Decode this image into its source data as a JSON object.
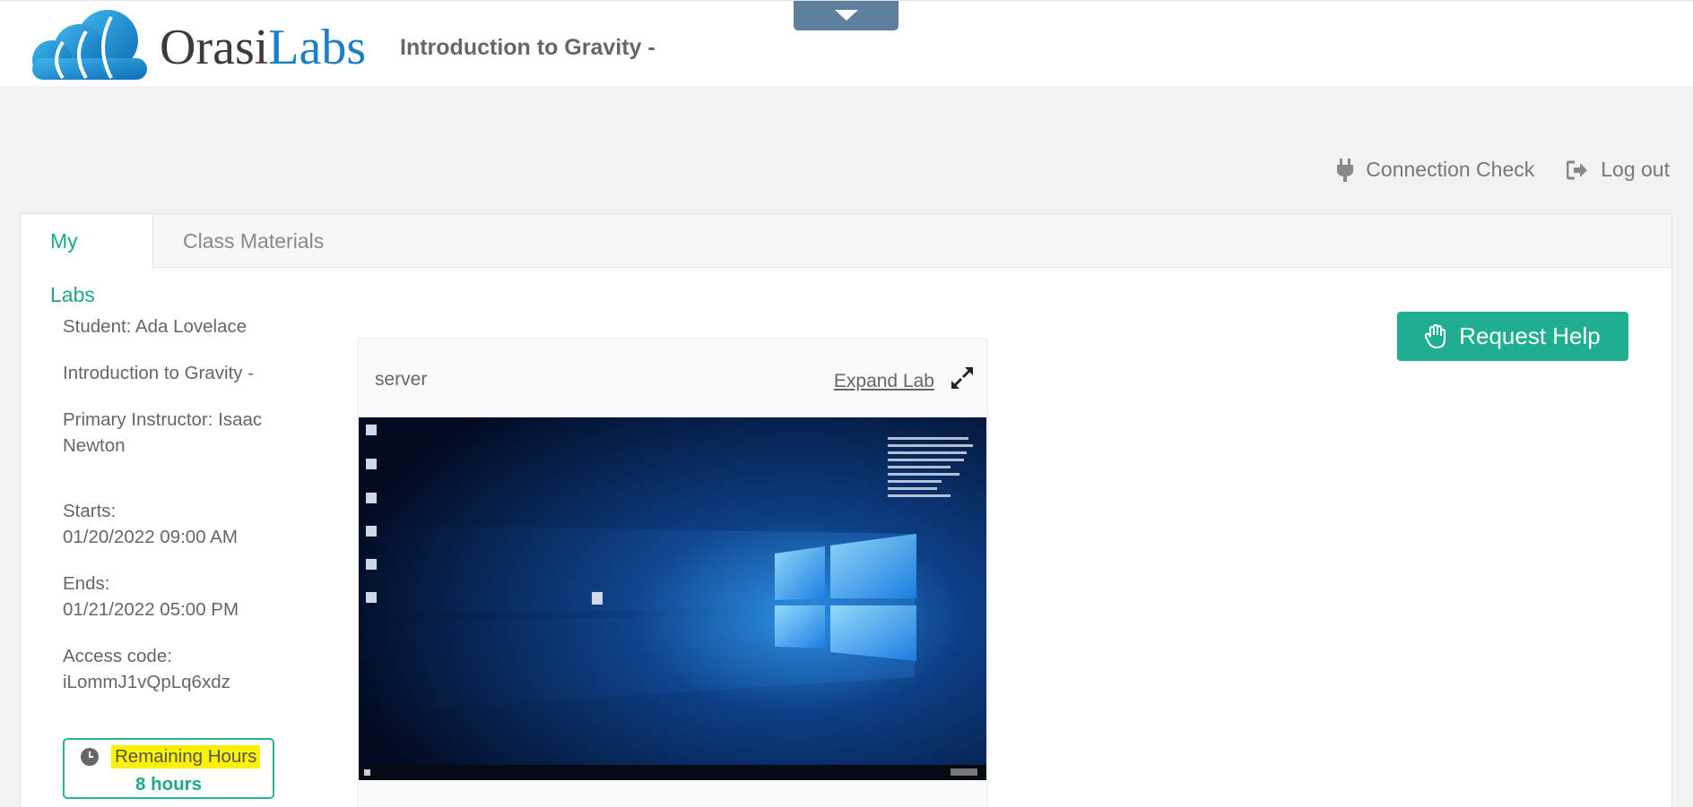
{
  "header": {
    "logo_text_a": "Orasi",
    "logo_text_b": "Labs",
    "title": "Introduction to Gravity -"
  },
  "top_links": {
    "connection_check": "Connection Check",
    "logout": "Log out"
  },
  "tabs": [
    {
      "label": "My Labs",
      "active": true
    },
    {
      "label": "Class Materials",
      "active": false
    }
  ],
  "info": {
    "student": "Student: Ada Lovelace",
    "course": "Introduction to Gravity -",
    "instructor": "Primary Instructor: Isaac Newton",
    "starts_label": "Starts:",
    "starts_value": "01/20/2022 09:00 AM",
    "ends_label": "Ends:",
    "ends_value": "01/21/2022 05:00 PM",
    "access_label": "Access code:",
    "access_value": "iLommJ1vQpLq6xdz"
  },
  "remaining": {
    "label": "Remaining Hours",
    "value": "8 hours"
  },
  "lab": {
    "name": "server",
    "expand_label": "Expand Lab"
  },
  "help_button": "Request Help",
  "colors": {
    "accent": "#1fae8f",
    "highlight": "#fbf200",
    "dropdown_tab": "#5f7f9f",
    "logo_blue": "#1a7fc4"
  },
  "icons": {
    "dropdown": "chevron-down-icon",
    "connection": "plug-icon",
    "logout": "sign-out-icon",
    "clock": "clock-icon",
    "expand": "expand-icon",
    "help": "hand-icon"
  }
}
